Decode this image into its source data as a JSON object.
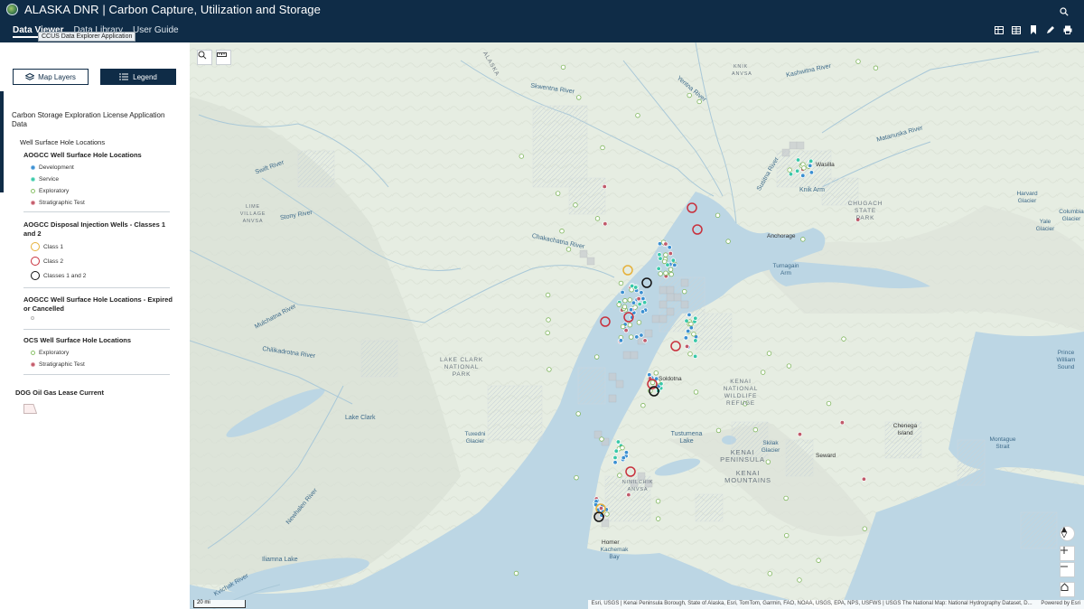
{
  "header": {
    "title": "ALASKA DNR | Carbon Capture, Utilization and Storage",
    "nav": [
      "Data Viewer",
      "Data Library",
      "User Guide"
    ],
    "tooltip": "CCUS Data Explorer Application",
    "icons": [
      "search-icon",
      "table-icon",
      "grid-icon",
      "bookmark-icon",
      "pencil-icon",
      "print-icon"
    ]
  },
  "sidebar": {
    "map_layers_label": "Map Layers",
    "legend_label": "Legend",
    "legend_title": "Carbon Storage Exploration License Application Data",
    "subtitle": "Well Surface Hole Locations",
    "groups": [
      {
        "title": "AOGCC Well Surface Hole Locations",
        "items": [
          "Development",
          "Service",
          "Exploratory",
          "Stratigraphic Test"
        ]
      },
      {
        "title": "AOGCC Disposal Injection Wells - Classes 1 and 2",
        "items": [
          "Class 1",
          "Class 2",
          "Classes 1 and 2"
        ]
      },
      {
        "title": "AOGCC Well Surface Hole Locations - Expired or Cancelled",
        "items": [
          ""
        ]
      },
      {
        "title": "OCS Well Surface Hole Locations",
        "items": [
          "Exploratory",
          "Stratigraphic Test"
        ]
      }
    ],
    "lease_title": "DOG Oil Gas Lease Current",
    "colors": {
      "development": "#3a8fd1",
      "service": "#38c8a8",
      "exploratory": "#9bd17a",
      "strat": "#c05a6a",
      "class1": "#e6b13a",
      "class2": "#c8303c",
      "class12": "#111111"
    }
  },
  "map": {
    "labels": {
      "kashwitna": "Kashwitna River",
      "skwentna": "Skwentna River",
      "yentna": "Yentna River",
      "susitna": "Susitna River",
      "matanuska": "Matanuska River",
      "knik": "Knik Arm",
      "anchorage": "Anchorage",
      "turnagain": "Turnagain Arm",
      "chakachatna": "Chakachatna River",
      "stony": "Stony River",
      "swift": "Swift River",
      "chilikadrotna": "Chilikadrotna River",
      "mulchatna": "Mulchatna River",
      "newhalen": "Newhalen River",
      "lake_clark_np": "LAKE CLARK NATIONAL PARK",
      "lake_clark": "Lake Clark",
      "soldotna": "Soldotna",
      "kenai_refuge": "KENAI NATIONAL WILDLIFE REFUGE",
      "tustumena": "Tustumena Lake",
      "kenai_peninsula": "KENAI PENINSULA",
      "kenai_mountains": "KENAI MOUNTAINS",
      "homer": "Homer",
      "kachemak": "Kachemak Bay",
      "seward": "Seward",
      "iliamna": "Iliamna Lake",
      "alaska_range": "ALASKA",
      "chugach": "CHUGACH STATE PARK",
      "harvard": "Harvard Glacier",
      "yale": "Yale Glacier",
      "columbia": "Columbia Glacier",
      "pws": "Prince William Sound",
      "montague": "Montague Strait",
      "chenega": "Chenega Island",
      "wasilla": "Wasilla",
      "skilak": "Skilak Glacier",
      "kvichak": "Kvichak River",
      "tuxedni": "Tuxedni Glacier",
      "ninilchik": "NINILCHIK ANVSA",
      "lime_village": "LIME VILLAGE ANVSA",
      "knik_anvsa": "KNIK ANVSA"
    },
    "attribution": "Esri, USGS | Kenai Peninsula Borough, State of Alaska, Esri, TomTom, Garmin, FAO, NOAA, USGS, EPA, NPS, USFWS | USGS The National Map: National Hydrography Dataset, D...",
    "powered_by": "Powered by Esri",
    "scale": "20 mi"
  }
}
